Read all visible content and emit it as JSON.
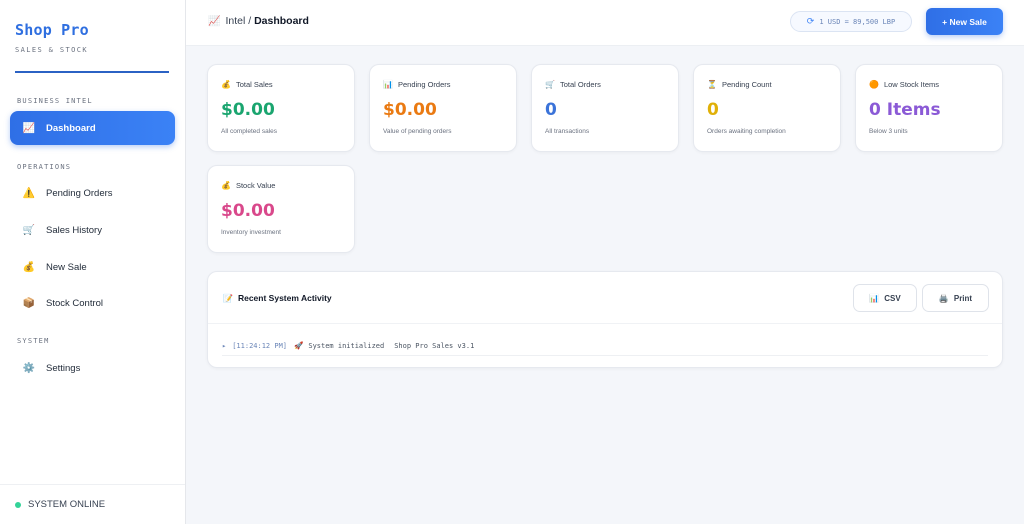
{
  "sidebar": {
    "brand": "Shop Pro",
    "brand_sub": "SALES & STOCK",
    "sections": {
      "business": "BUSINESS INTEL",
      "operations": "OPERATIONS",
      "system": "SYSTEM"
    },
    "items": {
      "dashboard": "Dashboard",
      "pending_orders": "Pending Orders",
      "sales_history": "Sales History",
      "new_sale": "New Sale",
      "stock_control": "Stock Control",
      "settings": "Settings"
    },
    "footer_status": "SYSTEM ONLINE"
  },
  "topbar": {
    "crumb_parent": "Intel /",
    "crumb_current": "Dashboard",
    "rate": "1 USD = 89,500 LBP",
    "new_sale_label": "+ New Sale"
  },
  "cards": {
    "total_sales": {
      "label": "Total Sales",
      "value": "$0.00",
      "sub": "All completed sales",
      "color": "#1aa56f"
    },
    "pending_orders": {
      "label": "Pending Orders",
      "value": "$0.00",
      "sub": "Value of pending orders",
      "color": "#ea7a12"
    },
    "total_orders": {
      "label": "Total Orders",
      "value": "0",
      "sub": "All transactions",
      "color": "#3b73d9"
    },
    "pending_count": {
      "label": "Pending Count",
      "value": "0",
      "sub": "Orders awaiting completion",
      "color": "#e0b008"
    },
    "low_stock": {
      "label": "Low Stock Items",
      "value": "0 Items",
      "sub": "Below 3 units",
      "color": "#8b5ad6"
    },
    "stock_value": {
      "label": "Stock Value",
      "value": "$0.00",
      "sub": "Inventory investment",
      "color": "#d9488b"
    }
  },
  "activity": {
    "title": "Recent System Activity",
    "csv_label": "CSV",
    "print_label": "Print",
    "log": {
      "arrow": "▸",
      "time": "[11:24:12 PM]",
      "message": "System initialized",
      "detail": "Shop Pro Sales v3.1"
    }
  }
}
